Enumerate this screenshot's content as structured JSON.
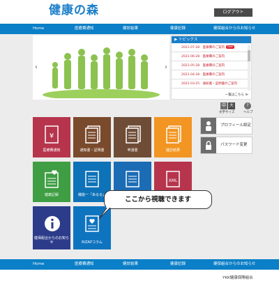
{
  "header": {
    "logo": "健康の森",
    "logout_label": "ログアウト"
  },
  "nav": {
    "items": [
      "Home",
      "医療費通知",
      "健診結果",
      "健康記録",
      "健保組合からのお知らせ"
    ]
  },
  "topics": {
    "title": "トピックス",
    "rows": [
      {
        "text": "2021-07-28　医療費のご案内",
        "new": "New"
      },
      {
        "text": "2021-06-28　医療費のご案内"
      },
      {
        "text": "2021-05-28　医療費のご案内"
      },
      {
        "text": "2021-04-28　医療費のご案内"
      },
      {
        "text": "2021-03-25　通知書・証明書のご案内"
      }
    ],
    "more": "一覧はこちら ≫"
  },
  "controls": {
    "size_small": "中",
    "size_large": "大",
    "help": "?",
    "size_label": "文字サイズ",
    "help_label": "ヘルプ"
  },
  "tiles": [
    {
      "label": "医療費通知",
      "color": "#b6354c"
    },
    {
      "label": "通知書・証明書",
      "color": "#7a4a2c"
    },
    {
      "label": "申請書",
      "color": "#6e4c36"
    },
    {
      "label": "健診結果",
      "color": "#f29522"
    },
    {
      "label": "健康記録",
      "color": "#3f9e43"
    },
    {
      "label": "機能一「あるる」",
      "color": "#0d72b8"
    },
    {
      "label": "",
      "color": "#1b6cb5"
    },
    {
      "label": "XML",
      "color": "#b6354c"
    },
    {
      "label": "健保組合からのお知らせ",
      "color": "#2d3c8a"
    },
    {
      "label": "RIZAPコラム",
      "color": "#0f74c0"
    }
  ],
  "side": {
    "profile": "プロフィール設定",
    "password": "パスワード変更"
  },
  "callout": "ここから視聴できます",
  "footer": {
    "org": "YKK健康保険組合"
  }
}
